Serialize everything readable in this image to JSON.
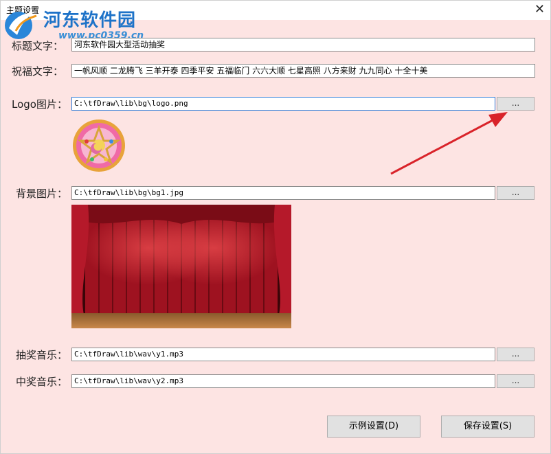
{
  "window": {
    "title": "主题设置",
    "close_glyph": "✕"
  },
  "watermark": {
    "name": "河东软件园",
    "url": "www.pc0359.cn"
  },
  "form": {
    "title_label": "标题文字：",
    "title_value": "河东软件园大型活动抽奖",
    "blessing_label": "祝福文字：",
    "blessing_value": "一帆风顺  二龙腾飞  三羊开泰  四季平安  五福临门  六六大顺  七星高照  八方来财  九九同心  十全十美",
    "logo_label": "Logo图片：",
    "logo_path": "C:\\tfDraw\\lib\\bg\\logo.png",
    "bg_label": "背景图片：",
    "bg_path": "C:\\tfDraw\\lib\\bg\\bg1.jpg",
    "draw_music_label": "抽奖音乐：",
    "draw_music_path": "C:\\tfDraw\\lib\\wav\\y1.mp3",
    "win_music_label": "中奖音乐：",
    "win_music_path": "C:\\tfDraw\\lib\\wav\\y2.mp3",
    "browse_label": "..."
  },
  "buttons": {
    "example_label": "示例设置(D)",
    "save_label": "保存设置(S)"
  },
  "colors": {
    "background": "#fde4e3",
    "watermark_blue": "#1e73c8",
    "arrow_red": "#d9232a",
    "curtain_red": "#9e1220"
  },
  "icons": [
    "close-icon",
    "watermark-logo-icon",
    "logo-preview-image",
    "stage-preview-image",
    "red-arrow-annotation"
  ]
}
